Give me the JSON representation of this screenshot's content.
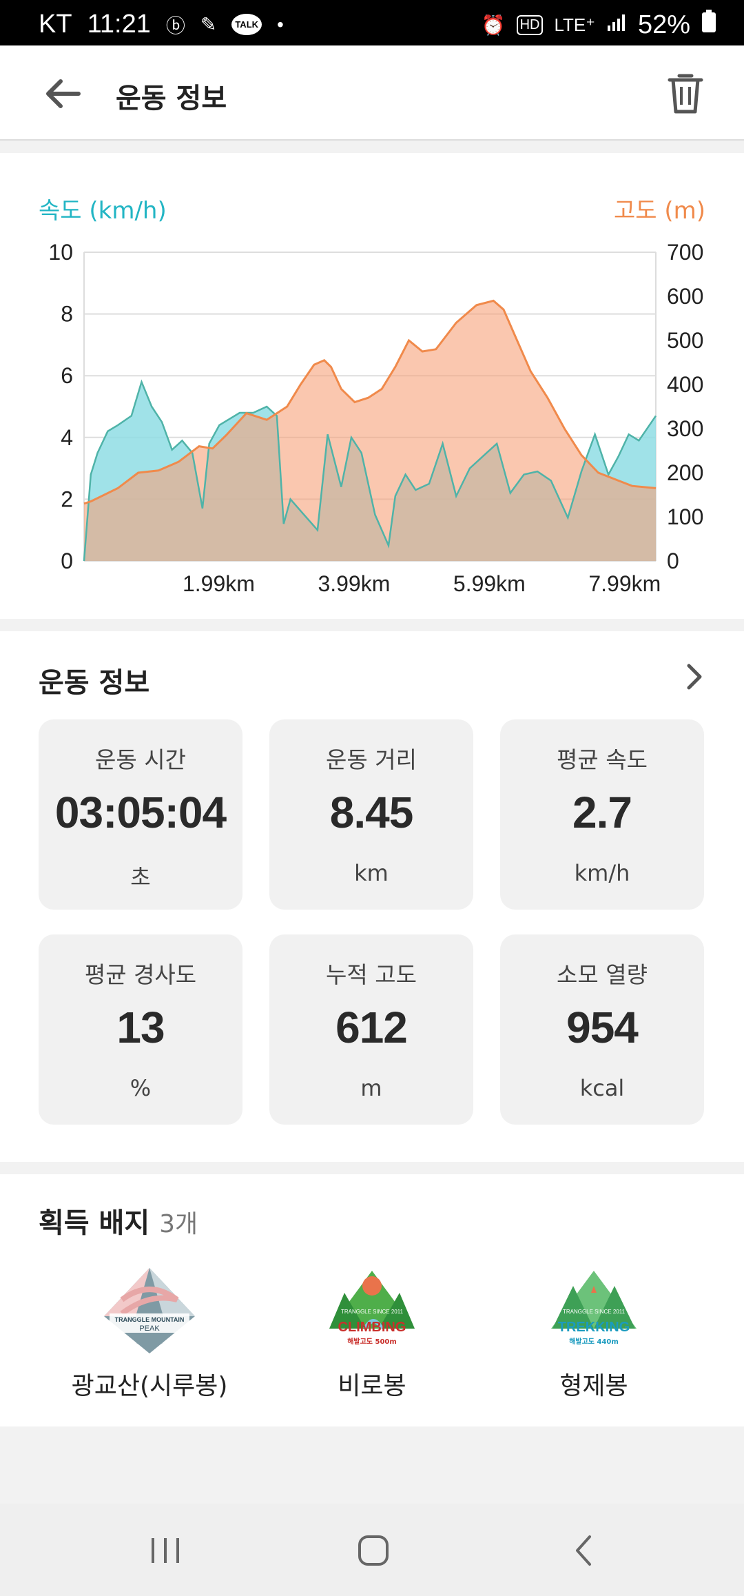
{
  "status_bar": {
    "carrier": "KT",
    "time": "11:21",
    "talk": "TALK",
    "hd": "HD",
    "network": "LTE⁺",
    "battery": "52%"
  },
  "app_bar": {
    "title": "운동 정보"
  },
  "chart": {
    "left_label": "속도 (km/h)",
    "right_label": "고도 (m)",
    "speed_color": "#22b5c4",
    "altitude_color": "#f08a4b"
  },
  "chart_data": {
    "type": "area",
    "x_ticks": [
      "1.99km",
      "3.99km",
      "5.99km",
      "7.99km"
    ],
    "xlim": [
      0,
      8.45
    ],
    "series": [
      {
        "name": "속도 (km/h)",
        "axis": "left",
        "ylim": [
          0,
          10
        ],
        "y_ticks": [
          0,
          2,
          4,
          6,
          8,
          10
        ],
        "x": [
          0,
          0.1,
          0.2,
          0.35,
          0.5,
          0.7,
          0.85,
          1.0,
          1.15,
          1.3,
          1.45,
          1.6,
          1.75,
          1.85,
          2.0,
          2.15,
          2.3,
          2.5,
          2.7,
          2.85,
          2.95,
          3.05,
          3.25,
          3.45,
          3.6,
          3.8,
          3.95,
          4.1,
          4.3,
          4.5,
          4.6,
          4.75,
          4.9,
          5.1,
          5.3,
          5.5,
          5.7,
          5.95,
          6.1,
          6.3,
          6.5,
          6.7,
          6.9,
          7.15,
          7.35,
          7.55,
          7.75,
          7.9,
          8.05,
          8.2,
          8.45
        ],
        "y": [
          0,
          2.8,
          3.5,
          4.2,
          4.4,
          4.7,
          5.8,
          5.0,
          4.5,
          3.6,
          3.9,
          3.5,
          1.7,
          3.8,
          4.4,
          4.6,
          4.8,
          4.8,
          5.0,
          4.7,
          1.2,
          2.0,
          1.5,
          1.0,
          4.1,
          2.4,
          4.0,
          3.5,
          1.5,
          0.5,
          2.1,
          2.8,
          2.3,
          2.5,
          3.8,
          2.1,
          3.0,
          3.5,
          3.8,
          2.2,
          2.8,
          2.9,
          2.6,
          1.4,
          2.9,
          4.1,
          2.8,
          3.4,
          4.1,
          3.9,
          4.7
        ]
      },
      {
        "name": "고도 (m)",
        "axis": "right",
        "ylim": [
          0,
          700
        ],
        "y_ticks": [
          0,
          100,
          200,
          300,
          400,
          500,
          600,
          700
        ],
        "x": [
          0,
          0.1,
          0.3,
          0.5,
          0.8,
          1.1,
          1.4,
          1.7,
          1.9,
          2.1,
          2.4,
          2.7,
          3.0,
          3.2,
          3.4,
          3.55,
          3.65,
          3.8,
          4.0,
          4.2,
          4.4,
          4.6,
          4.8,
          5.0,
          5.2,
          5.5,
          5.8,
          6.05,
          6.2,
          6.4,
          6.6,
          6.85,
          7.1,
          7.35,
          7.6,
          7.85,
          8.1,
          8.45
        ],
        "y": [
          130,
          135,
          150,
          165,
          200,
          205,
          225,
          260,
          255,
          285,
          335,
          320,
          350,
          400,
          445,
          455,
          440,
          390,
          360,
          370,
          390,
          440,
          500,
          475,
          480,
          540,
          580,
          590,
          570,
          500,
          430,
          370,
          300,
          240,
          200,
          185,
          170,
          165
        ]
      }
    ]
  },
  "exercise": {
    "section_title": "운동 정보",
    "stats": [
      {
        "label": "운동 시간",
        "value": "03:05:04",
        "unit": "초"
      },
      {
        "label": "운동 거리",
        "value": "8.45",
        "unit": "km"
      },
      {
        "label": "평균 속도",
        "value": "2.7",
        "unit": "km/h"
      },
      {
        "label": "평균 경사도",
        "value": "13",
        "unit": "%"
      },
      {
        "label": "누적 고도",
        "value": "612",
        "unit": "m"
      },
      {
        "label": "소모 열량",
        "value": "954",
        "unit": "kcal"
      }
    ]
  },
  "badges": {
    "section_title": "획득 배지",
    "count": "3개",
    "items": [
      {
        "name": "광교산(시루봉)",
        "text1": "TRANGGLE MOUNTAIN",
        "text2": "PEAK"
      },
      {
        "name": "비로봉",
        "text1": "TRANGGLE SINCE 2011",
        "text2": "CLIMBING",
        "text3": "해발고도 500m"
      },
      {
        "name": "형제봉",
        "text1": "TRANGGLE SINCE 2011",
        "text2": "TREKKING",
        "text3": "해발고도 440m"
      }
    ]
  }
}
